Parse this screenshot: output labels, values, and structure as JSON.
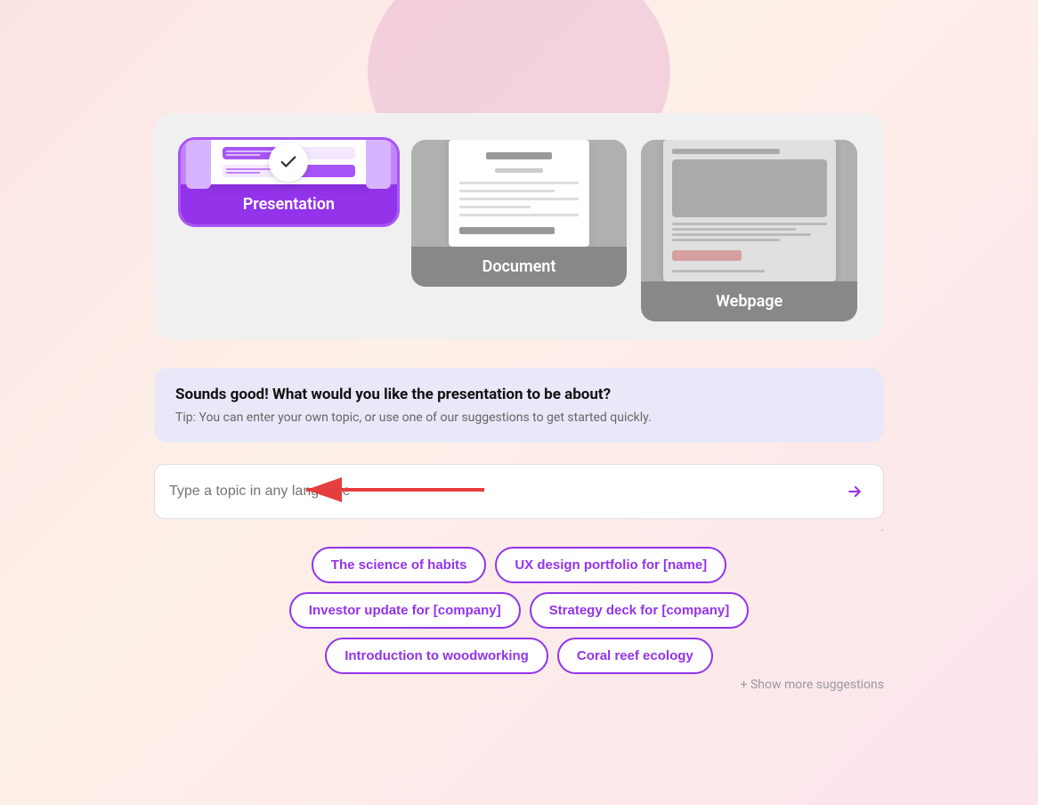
{
  "typeselector": {
    "options": [
      {
        "id": "presentation",
        "label": "Presentation",
        "selected": true
      },
      {
        "id": "document",
        "label": "Document",
        "selected": false
      },
      {
        "id": "webpage",
        "label": "Webpage",
        "selected": false
      }
    ]
  },
  "chat": {
    "question": "Sounds good! What would you like the presentation to be about?",
    "tip": "Tip: You can enter your own topic, or use one of our suggestions to get started quickly."
  },
  "input": {
    "placeholder": "Type a topic in any language",
    "value": ""
  },
  "suggestions": {
    "rows": [
      [
        {
          "label": "The science of habits"
        },
        {
          "label": "UX design portfolio for [name]"
        }
      ],
      [
        {
          "label": "Investor update for [company]"
        },
        {
          "label": "Strategy deck for [company]"
        }
      ],
      [
        {
          "label": "Introduction to woodworking"
        },
        {
          "label": "Coral reef ecology"
        }
      ]
    ],
    "show_more_label": "+ Show more suggestions"
  }
}
